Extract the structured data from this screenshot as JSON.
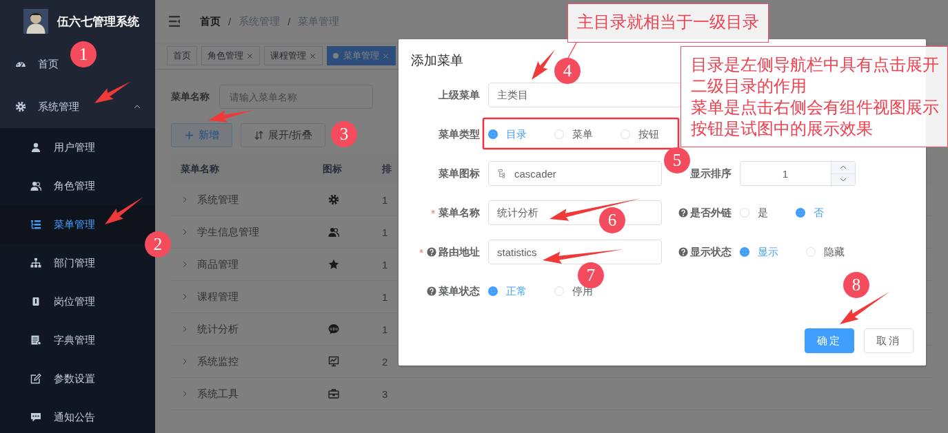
{
  "sidebar": {
    "title": "伍六七管理系统",
    "items": [
      {
        "label": "首页",
        "selected": false
      },
      {
        "label": "系统管理",
        "selected": false,
        "expanded": true,
        "children": [
          {
            "label": "用户管理",
            "selected": false
          },
          {
            "label": "角色管理",
            "selected": false
          },
          {
            "label": "菜单管理",
            "selected": true
          },
          {
            "label": "部门管理",
            "selected": false
          },
          {
            "label": "岗位管理",
            "selected": false
          },
          {
            "label": "字典管理",
            "selected": false
          },
          {
            "label": "参数设置",
            "selected": false
          },
          {
            "label": "通知公告",
            "selected": false
          }
        ]
      }
    ]
  },
  "header": {
    "separator": "/",
    "breadcrumb": [
      {
        "label": "首页",
        "link": true
      },
      {
        "label": "系统管理",
        "link": false
      },
      {
        "label": "菜单管理",
        "link": false
      }
    ]
  },
  "tags": [
    {
      "label": "首页",
      "closable": false,
      "selected": false
    },
    {
      "label": "角色管理",
      "closable": true,
      "selected": false
    },
    {
      "label": "课程管理",
      "closable": true,
      "selected": false
    },
    {
      "label": "菜单管理",
      "closable": true,
      "selected": true
    }
  ],
  "search": {
    "label": "菜单名称",
    "placeholder": "请输入菜单名称"
  },
  "toolbar": [
    {
      "label": "新增",
      "kind": "primary"
    },
    {
      "label": "展开/折叠",
      "kind": "default"
    }
  ],
  "table": {
    "columns": [
      "菜单名称",
      "图标",
      "排"
    ],
    "rows": [
      {
        "name": "系统管理",
        "order": "1"
      },
      {
        "name": "学生信息管理",
        "order": "1"
      },
      {
        "name": "商品管理",
        "order": "1"
      },
      {
        "name": "课程管理",
        "order": "1"
      },
      {
        "name": "统计分析",
        "order": "1"
      },
      {
        "name": "系统监控",
        "order": "2"
      },
      {
        "name": "系统工具",
        "order": "3"
      }
    ]
  },
  "dialog": {
    "title": "添加菜单",
    "rows": [
      [
        {
          "label": "上级菜单",
          "kind": "select",
          "value": "主类目"
        }
      ],
      [
        {
          "label": "菜单类型",
          "kind": "radio",
          "options": [
            {
              "label": "目录",
              "selected": true
            },
            {
              "label": "菜单",
              "selected": false
            },
            {
              "label": "按钮",
              "selected": false
            }
          ]
        }
      ],
      [
        {
          "label": "菜单图标",
          "kind": "icon_input",
          "value": "cascader"
        },
        {
          "label": "显示排序",
          "kind": "number",
          "value": "1"
        }
      ],
      [
        {
          "label": "菜单名称",
          "kind": "input",
          "asterisk": "*",
          "value": "统计分析"
        },
        {
          "label": "是否外链",
          "kind": "radio",
          "help": true,
          "options": [
            {
              "label": "是",
              "selected": false
            },
            {
              "label": "否",
              "selected": true
            }
          ]
        }
      ],
      [
        {
          "label": "路由地址",
          "kind": "input",
          "asterisk": "*",
          "help": true,
          "value": "statistics"
        },
        {
          "label": "显示状态",
          "kind": "radio",
          "help": true,
          "options": [
            {
              "label": "显示",
              "selected": true
            },
            {
              "label": "隐藏",
              "selected": false
            }
          ]
        }
      ],
      [
        {
          "label": "菜单状态",
          "kind": "radio",
          "help": true,
          "options": [
            {
              "label": "正常",
              "selected": true
            },
            {
              "label": "停用",
              "selected": false
            }
          ]
        }
      ]
    ],
    "buttons": [
      {
        "label": "确定",
        "kind": "primary"
      },
      {
        "label": "取消",
        "kind": "default"
      }
    ]
  },
  "annotations": {
    "notes": [
      {
        "lines": [
          "主目录就相当于一级目录"
        ]
      },
      {
        "lines": [
          "目录是左侧导航栏中具有点击展开二级目录的作用",
          "菜单是点击右侧会有组件视图展示",
          "按钮是试图中的展示效果"
        ]
      }
    ],
    "markers": [
      "1",
      "2",
      "3",
      "4",
      "5",
      "6",
      "7",
      "8"
    ]
  }
}
